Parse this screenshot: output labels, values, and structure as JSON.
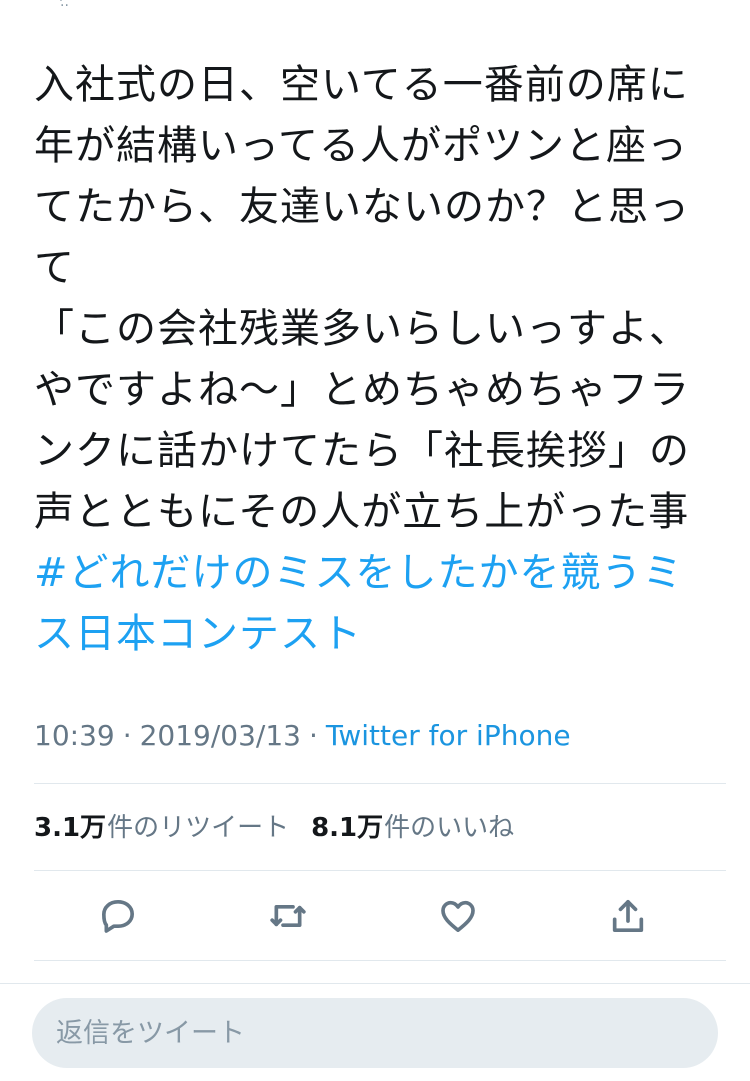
{
  "tweet": {
    "text": "入社式の日、空いてる一番前の席に年が結構いってる人がポツンと座ってたから、友達いないのか？と思って\n「この会社残業多いらしいっすよ、やですよね〜」とめちゃめちゃフランクに話かけてたら「社長挨拶」の声とともにその人が立ち上がった事 ",
    "hashtag": "#どれだけのミスをしたかを競うミス日本コンテスト"
  },
  "meta": {
    "time": "10:39",
    "separator": "·",
    "date": "2019/03/13",
    "source": "Twitter for iPhone"
  },
  "stats": {
    "retweets_count": "3.1万",
    "retweets_label": "件のリツイート",
    "likes_count": "8.1万",
    "likes_label": "件のいいね"
  },
  "actions": {
    "reply_icon": "reply-icon",
    "retweet_icon": "retweet-icon",
    "like_icon": "heart-icon",
    "share_icon": "share-icon"
  },
  "reply": {
    "placeholder": "返信をツイート"
  },
  "colors": {
    "text": "#14171a",
    "secondary": "#657786",
    "link": "#1da1f2",
    "divider": "#e1e8ed",
    "reply_bg": "#e6ecf0"
  }
}
